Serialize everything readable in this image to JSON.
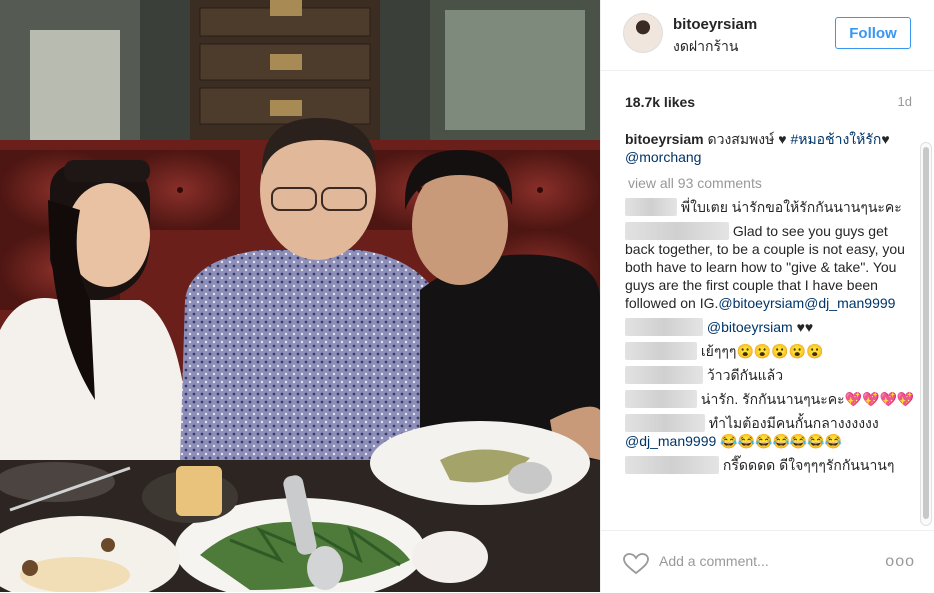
{
  "post": {
    "username": "bitoeyrsiam",
    "location": "งดฝากร้าน",
    "follow_label": "Follow",
    "likes": "18.7k likes",
    "time_ago": "1d"
  },
  "caption": {
    "username": "bitoeyrsiam",
    "text": "ดวงสมพงษ์ ♥ ",
    "hashtag": "#หมอช้างให้รัก",
    "text2": "♥ ",
    "mention": "@morchang"
  },
  "view_all": "view all 93 comments",
  "comments": [
    {
      "text": "พี่ใบเตย น่ารักขอให้รักกันนานๆนะคะ"
    },
    {
      "text": "Glad to see you guys get back together, to be a couple is not easy, you both have to learn how to \"give & take\". You guys are the first couple that I have been followed on IG.",
      "mention": "@bitoeyrsiam@dj_man9999"
    },
    {
      "mention": "@bitoeyrsiam",
      "text": " ♥♥"
    },
    {
      "text": "เย้ๆๆๆ😮😮😮😮😮"
    },
    {
      "text": "ว้าวดีกันแล้ว"
    },
    {
      "text": "น่ารัก. รักกันนานๆนะคะ💖💖💖💖"
    },
    {
      "text": "ทำไมต้องมีคนกั้นกลางงงงงง",
      "mention": "@dj_man9999",
      "text2": " 😂😂😂😂😂😂😂"
    },
    {
      "text": "กรี๊ดดดด ดีใจๆๆๆรักกันนานๆ"
    }
  ],
  "footer": {
    "icon": "heart-outline-icon",
    "add_comment_placeholder": "Add a comment...",
    "more_label": "ooo"
  },
  "colors": {
    "accent": "#3897f0",
    "link": "#003569",
    "muted": "#999999"
  }
}
